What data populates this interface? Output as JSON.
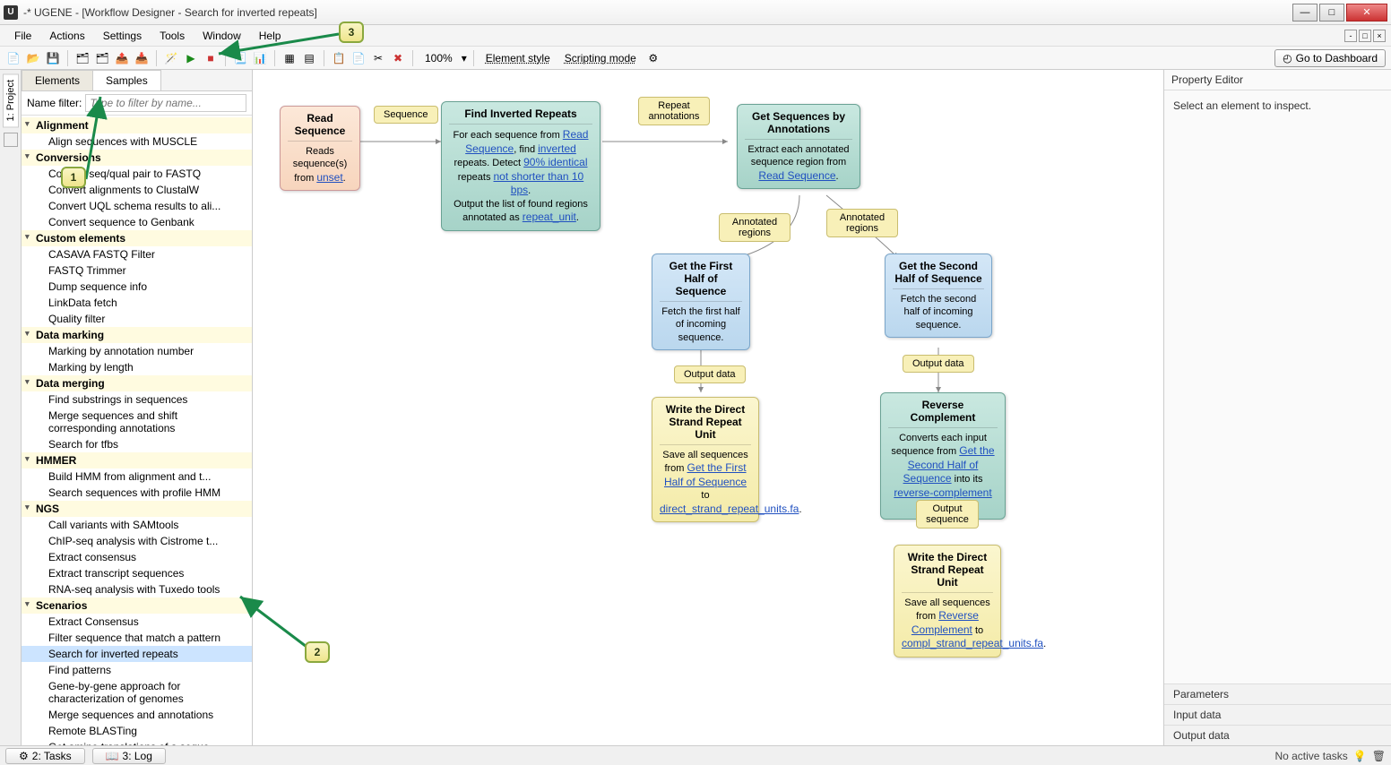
{
  "window": {
    "title": "-* UGENE - [Workflow Designer - Search for inverted repeats]"
  },
  "menu": {
    "items": [
      "File",
      "Actions",
      "Settings",
      "Tools",
      "Window",
      "Help"
    ]
  },
  "toolbar": {
    "zoom": "100%",
    "element_style": "Element style",
    "scripting_mode": "Scripting mode",
    "dashboard": "Go to Dashboard"
  },
  "vtab": {
    "project": "1: Project"
  },
  "sidebar": {
    "tabs": {
      "elements": "Elements",
      "samples": "Samples"
    },
    "filter_label": "Name filter:",
    "filter_placeholder": "Type to filter by name...",
    "tree": [
      {
        "type": "cat",
        "label": "Alignment"
      },
      {
        "type": "leaf",
        "label": "Align sequences with MUSCLE"
      },
      {
        "type": "cat",
        "label": "Conversions"
      },
      {
        "type": "leaf",
        "label": "Convert seq/qual pair to FASTQ"
      },
      {
        "type": "leaf",
        "label": "Convert alignments to ClustalW"
      },
      {
        "type": "leaf",
        "label": "Convert UQL schema results to ali..."
      },
      {
        "type": "leaf",
        "label": "Convert sequence to Genbank"
      },
      {
        "type": "cat",
        "label": "Custom elements"
      },
      {
        "type": "leaf",
        "label": "CASAVA FASTQ Filter"
      },
      {
        "type": "leaf",
        "label": "FASTQ Trimmer"
      },
      {
        "type": "leaf",
        "label": "Dump sequence info"
      },
      {
        "type": "leaf",
        "label": "LinkData fetch"
      },
      {
        "type": "leaf",
        "label": "Quality filter"
      },
      {
        "type": "cat",
        "label": "Data marking"
      },
      {
        "type": "leaf",
        "label": "Marking by annotation number"
      },
      {
        "type": "leaf",
        "label": "Marking by length"
      },
      {
        "type": "cat",
        "label": "Data merging"
      },
      {
        "type": "leaf",
        "label": "Find substrings in sequences"
      },
      {
        "type": "leaf",
        "label": "Merge sequences and shift corresponding annotations"
      },
      {
        "type": "leaf",
        "label": "Search for tfbs"
      },
      {
        "type": "cat",
        "label": "HMMER"
      },
      {
        "type": "leaf",
        "label": "Build HMM from alignment and t..."
      },
      {
        "type": "leaf",
        "label": "Search sequences with profile HMM"
      },
      {
        "type": "cat",
        "label": "NGS"
      },
      {
        "type": "leaf",
        "label": "Call variants with SAMtools"
      },
      {
        "type": "leaf",
        "label": "ChIP-seq analysis with Cistrome t..."
      },
      {
        "type": "leaf",
        "label": "Extract consensus"
      },
      {
        "type": "leaf",
        "label": "Extract transcript sequences"
      },
      {
        "type": "leaf",
        "label": "RNA-seq analysis with Tuxedo tools"
      },
      {
        "type": "cat",
        "label": "Scenarios"
      },
      {
        "type": "leaf",
        "label": "Extract Consensus"
      },
      {
        "type": "leaf",
        "label": "Filter sequence that match a pattern"
      },
      {
        "type": "leaf",
        "label": "Search for inverted repeats",
        "selected": true
      },
      {
        "type": "leaf",
        "label": "Find patterns"
      },
      {
        "type": "leaf",
        "label": "Gene-by-gene approach for characterization of genomes"
      },
      {
        "type": "leaf",
        "label": "Merge sequences and annotations"
      },
      {
        "type": "leaf",
        "label": "Remote BLASTing"
      },
      {
        "type": "leaf",
        "label": "Get amino translations of a seque..."
      }
    ]
  },
  "canvas": {
    "pills": {
      "sequence": "Sequence",
      "repeat_annotations": "Repeat annotations",
      "annotated_regions1": "Annotated regions",
      "annotated_regions2": "Annotated regions",
      "output_data1": "Output data",
      "output_data2": "Output data",
      "output_sequence": "Output sequence"
    },
    "nodes": {
      "read_seq": {
        "title": "Read Sequence",
        "desc": "Reads sequence(s) from <span class='lnk'>unset</span>."
      },
      "find_inv": {
        "title": "Find Inverted Repeats",
        "desc": "For each sequence from <span class='lnk'>Read Sequence</span>, find <span class='lnk'>inverted</span> repeats. Detect <span class='lnk'>90% identical</span> repeats <span class='lnk'>not shorter than 10 bps</span>.<br>Output the list of found regions annotated as <span class='lnk'>repeat_unit</span>."
      },
      "get_seq_ann": {
        "title": "Get Sequences by Annotations",
        "desc": "Extract each annotated sequence region from <span class='lnk'>Read Sequence</span>."
      },
      "get_first": {
        "title": "Get the First Half of Sequence",
        "desc": "Fetch the first half of incoming sequence."
      },
      "get_second": {
        "title": "Get the Second Half of Sequence",
        "desc": "Fetch the second half of incoming sequence."
      },
      "write_direct1": {
        "title": "Write the Direct Strand Repeat Unit",
        "desc": "Save all sequences from <span class='lnk'>Get the First Half of Sequence</span> to <span class='lnk'>direct_strand_repeat_units.fa</span>."
      },
      "reverse_comp": {
        "title": "Reverse Complement",
        "desc": "Converts each input sequence from <span class='lnk'>Get the Second Half of Sequence</span> into its <span class='lnk'>reverse-complement</span> counterpart."
      },
      "write_direct2": {
        "title": "Write the Direct Strand Repeat Unit",
        "desc": "Save all sequences from <span class='lnk'>Reverse Complement</span> to <span class='lnk'>compl_strand_repeat_units.fa</span>."
      }
    }
  },
  "propeditor": {
    "title": "Property Editor",
    "placeholder": "Select an element to inspect.",
    "parameters": "Parameters",
    "input_data": "Input data",
    "output_data": "Output data"
  },
  "bottombar": {
    "tasks": "2: Tasks",
    "log": "3: Log",
    "status": "No active tasks"
  },
  "callouts": {
    "c1": "1",
    "c2": "2",
    "c3": "3"
  }
}
